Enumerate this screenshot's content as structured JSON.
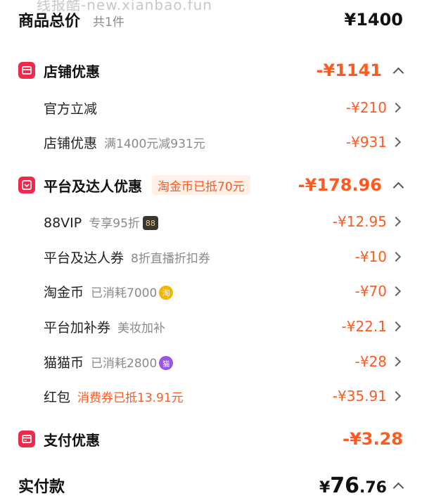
{
  "watermark": "线报酷-new.xianbao.fun",
  "total": {
    "label": "商品总价",
    "count": "共1件",
    "value": "¥1400"
  },
  "shop_discount": {
    "title": "店铺优惠",
    "value": "-¥1141",
    "items": [
      {
        "label": "官方立减",
        "sub": "",
        "value": "-¥210"
      },
      {
        "label": "店铺优惠",
        "sub": "满1400元减931元",
        "value": "-¥931"
      }
    ]
  },
  "platform_discount": {
    "title": "平台及达人优惠",
    "tag": "淘金币已抵70元",
    "value": "-¥178.96",
    "items": [
      {
        "label": "88VIP",
        "sub": "专享95折",
        "badge": "88",
        "value": "-¥12.95"
      },
      {
        "label": "平台及达人券",
        "sub": "8折直播折扣券",
        "value": "-¥10"
      },
      {
        "label": "淘金币",
        "sub": "已消耗7000",
        "value": "-¥70"
      },
      {
        "label": "平台加补券",
        "sub": "美妆加补",
        "value": "-¥22.1"
      },
      {
        "label": "猫猫币",
        "sub": "已消耗2800",
        "value": "-¥28"
      },
      {
        "label": "红包",
        "sub": "消费券已抵13.91元",
        "value": "-¥35.91"
      }
    ]
  },
  "payment_discount": {
    "title": "支付优惠",
    "value": "-¥3.28"
  },
  "paid": {
    "label": "实付款",
    "currency": "¥",
    "integer": "76",
    "decimal": ".76"
  },
  "colors": {
    "accent": "#ff5a1f",
    "icon_red": "#f0284a",
    "tag_bg": "#fff0e8"
  }
}
